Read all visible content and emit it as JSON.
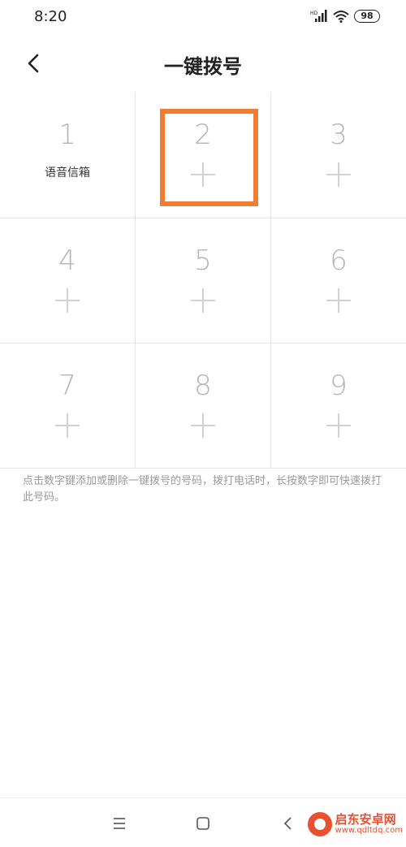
{
  "statusbar": {
    "time": "8:20",
    "battery": "98",
    "signal_label": "HD"
  },
  "header": {
    "title": "一键拨号"
  },
  "keys": [
    {
      "number": "1",
      "label": "语音信箱"
    },
    {
      "number": "2",
      "label": ""
    },
    {
      "number": "3",
      "label": ""
    },
    {
      "number": "4",
      "label": ""
    },
    {
      "number": "5",
      "label": ""
    },
    {
      "number": "6",
      "label": ""
    },
    {
      "number": "7",
      "label": ""
    },
    {
      "number": "8",
      "label": ""
    },
    {
      "number": "9",
      "label": ""
    }
  ],
  "hint": "点击数字键添加或删除一键拨号的号码，拨打电话时，长按数字即可快速拨打此号码。",
  "colors": {
    "highlight": "#f07d32",
    "number": "#b6b6b6",
    "plus": "#d2d2d2"
  },
  "watermark": {
    "title": "启东安卓网",
    "url": "www.qdltdq.com"
  }
}
